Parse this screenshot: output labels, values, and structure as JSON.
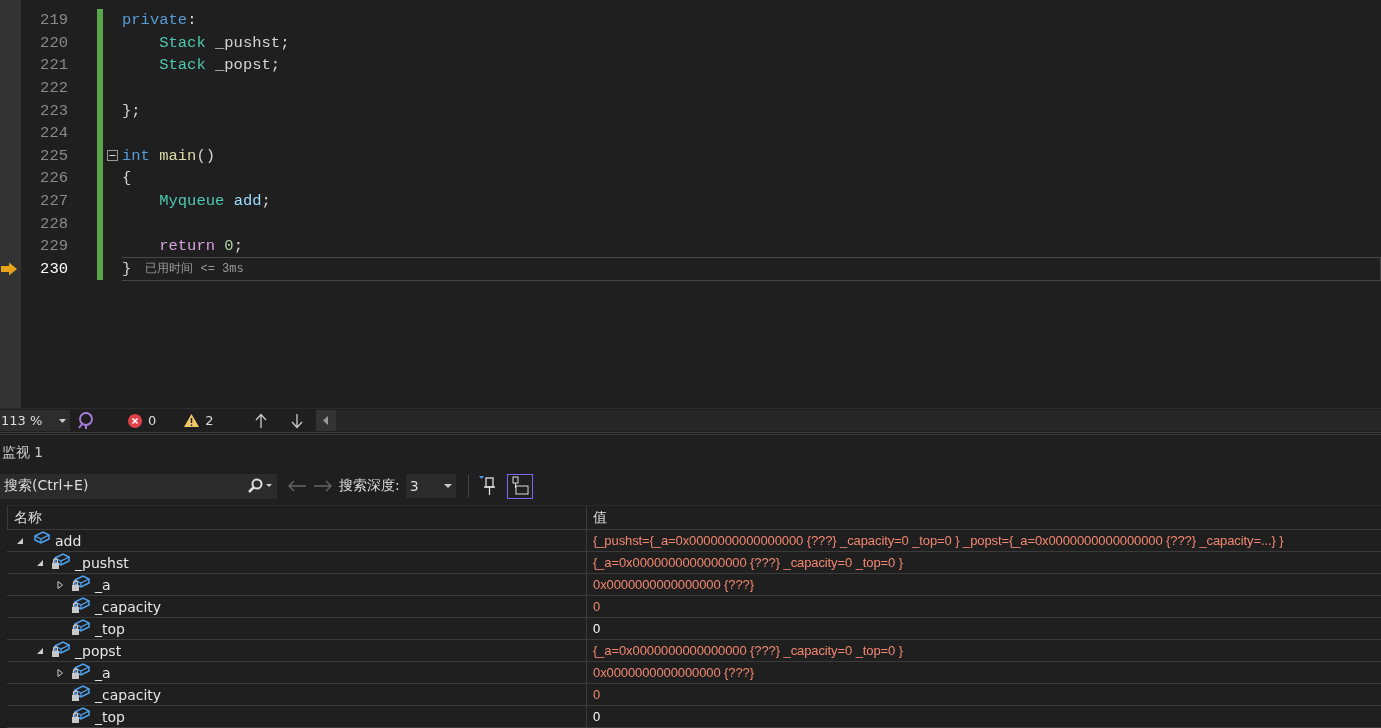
{
  "editor": {
    "lines": [
      {
        "number": "219",
        "current": false,
        "kind": "plain",
        "tokens": [
          {
            "kind": "keyword",
            "text": "private"
          },
          {
            "kind": "punct",
            "text": ":"
          }
        ]
      },
      {
        "number": "220",
        "current": false,
        "kind": "indented",
        "tokens": [
          {
            "kind": "type",
            "text": "Stack"
          },
          {
            "kind": "punct",
            "text": " _pushst;"
          }
        ]
      },
      {
        "number": "221",
        "current": false,
        "kind": "indented",
        "tokens": [
          {
            "kind": "type",
            "text": "Stack"
          },
          {
            "kind": "punct",
            "text": " _popst;"
          }
        ]
      },
      {
        "number": "222",
        "current": false
      },
      {
        "number": "223",
        "current": false,
        "kind": "plain",
        "tokens": [
          {
            "kind": "punct",
            "text": "};"
          }
        ]
      },
      {
        "number": "224",
        "current": false
      },
      {
        "number": "225",
        "current": false,
        "kind": "plain",
        "foldable": true,
        "tokens": [
          {
            "kind": "keyword",
            "text": "int"
          },
          {
            "kind": "func",
            "text": " main"
          },
          {
            "kind": "punct",
            "text": "()"
          }
        ]
      },
      {
        "number": "226",
        "current": false,
        "kind": "plain",
        "tokens": [
          {
            "kind": "punct",
            "text": "{"
          }
        ]
      },
      {
        "number": "227",
        "current": false,
        "kind": "indented",
        "tokens": [
          {
            "kind": "type",
            "text": "Myqueue"
          },
          {
            "kind": "ident",
            "text": " add"
          },
          {
            "kind": "punct",
            "text": ";"
          }
        ]
      },
      {
        "number": "228",
        "current": false
      },
      {
        "number": "229",
        "current": false,
        "kind": "indented",
        "tokens": [
          {
            "kind": "control",
            "text": "return"
          },
          {
            "kind": "number",
            "text": " 0"
          },
          {
            "kind": "punct",
            "text": ";"
          }
        ]
      },
      {
        "number": "230",
        "current": true,
        "kind": "plain",
        "tokens": [
          {
            "kind": "punct",
            "text": "}"
          }
        ],
        "hint": "已用时间 <= 3ms"
      }
    ]
  },
  "status_bar": {
    "zoom": "113 %",
    "errors": "0",
    "warnings": "2"
  },
  "watch": {
    "title": "监视 1",
    "search": {
      "placeholder": "搜索(Ctrl+E)"
    },
    "depth_label": "搜索深度:",
    "depth": "3",
    "columns": [
      "名称",
      "值"
    ],
    "rows": [
      {
        "name": "add",
        "value": "{_pushst={_a=0x0000000000000000 {???} _capacity=0 _top=0 } _popst={_a=0x0000000000000000 {???} _capacity=...} }",
        "changed": true,
        "locked": false,
        "expanded": true,
        "children": [
          {
            "name": "_pushst",
            "value": "{_a=0x0000000000000000 {???} _capacity=0 _top=0 }",
            "changed": true,
            "locked": true,
            "expanded": true,
            "children": [
              {
                "name": "_a",
                "value": "0x0000000000000000 {???}",
                "changed": true,
                "locked": true,
                "expanded": false
              },
              {
                "name": "_capacity",
                "value": "0",
                "changed": true,
                "locked": true
              },
              {
                "name": "_top",
                "value": "0",
                "changed": false,
                "locked": true
              }
            ]
          },
          {
            "name": "_popst",
            "value": "{_a=0x0000000000000000 {???} _capacity=0 _top=0 }",
            "changed": true,
            "locked": true,
            "expanded": true,
            "children": [
              {
                "name": "_a",
                "value": "0x0000000000000000 {???}",
                "changed": true,
                "locked": true,
                "expanded": false
              },
              {
                "name": "_capacity",
                "value": "0",
                "changed": true,
                "locked": true
              },
              {
                "name": "_top",
                "value": "0",
                "changed": false,
                "locked": true
              }
            ]
          }
        ]
      }
    ]
  }
}
